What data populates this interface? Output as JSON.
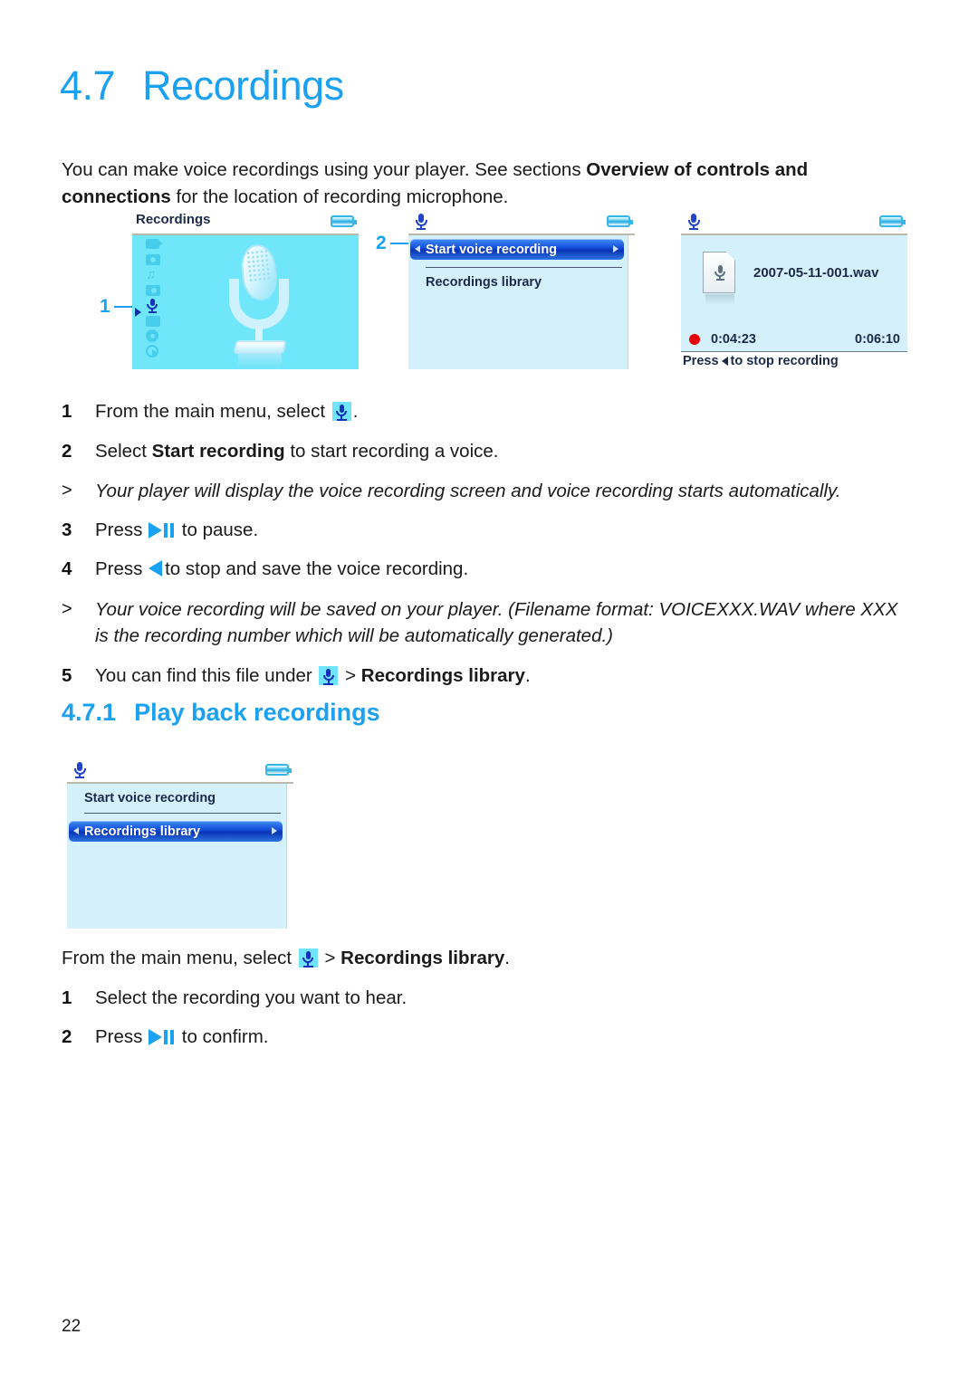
{
  "heading": {
    "number": "4.7",
    "title": "Recordings"
  },
  "intro": {
    "part1": "You can make voice recordings using your player. See sections ",
    "bold1": "Overview of controls and connections",
    "part2": " for the location of recording microphone."
  },
  "screens": {
    "screen1": {
      "title": "Recordings",
      "battery_icon": "battery-icon",
      "menu_icons": [
        "video-camera-icon",
        "camera-icon",
        "music-note-icon",
        "camera-radio-icon",
        "microphone-icon",
        "folder-icon",
        "gear-icon",
        "play-circle-icon"
      ],
      "selected_icon": "microphone-icon",
      "artwork": "microphone-illustration"
    },
    "screen2": {
      "title_icon": "microphone-icon",
      "battery_icon": "battery-icon",
      "items": [
        {
          "label": "Start voice recording",
          "selected": true
        },
        {
          "label": "Recordings library",
          "selected": false
        }
      ]
    },
    "screen3": {
      "title_icon": "microphone-icon",
      "battery_icon": "battery-icon",
      "file_icon": "wav-file-icon",
      "filename": "2007-05-11-001.wav",
      "record_indicator": "record-dot-icon",
      "elapsed_time": "0:04:23",
      "total_time": "0:06:10",
      "footer_before": "Press",
      "footer_after": "to stop recording"
    },
    "screen4": {
      "title_icon": "microphone-icon",
      "battery_icon": "battery-icon",
      "items": [
        {
          "label": "Start voice recording",
          "selected": false
        },
        {
          "label": "Recordings library",
          "selected": true
        }
      ]
    }
  },
  "callouts": [
    {
      "label": "1"
    },
    {
      "label": "2"
    }
  ],
  "steps_upper": [
    {
      "marker": "1",
      "text_before": "From the main menu, select ",
      "icon": "microphone-icon",
      "text_after": "."
    },
    {
      "marker": "2",
      "text_before": "Select ",
      "bold": "Start recording",
      "text_after": " to start recording a voice."
    },
    {
      "marker": ">",
      "italic": true,
      "text_before": "Your player will display the voice recording screen and voice recording starts automatically."
    },
    {
      "marker": "3",
      "text_before": "Press ",
      "icon": "play-pause-icon",
      "text_after": " to pause."
    },
    {
      "marker": "4",
      "text_before": "Press ",
      "icon": "left-arrow-icon",
      "text_after": "to stop and save the voice recording."
    },
    {
      "marker": ">",
      "italic": true,
      "text_before": "Your voice recording will be saved on your player. (Filename format: VOICEXXX.WAV where XXX is the recording number which will be automatically generated.)"
    },
    {
      "marker": "5",
      "text_before": "You can find this file under ",
      "icon": "microphone-icon",
      "text_mid": " > ",
      "bold": "Recordings library",
      "text_after": "."
    }
  ],
  "subheading": {
    "number": "4.7.1",
    "title": "Play back recordings"
  },
  "steps_lower": [
    {
      "marker": "",
      "text_before": "From the main menu, select ",
      "icon": "microphone-icon",
      "text_mid": " > ",
      "bold": "Recordings library",
      "text_after": "."
    },
    {
      "marker": "1",
      "text_before": "Select the recording you want to hear."
    },
    {
      "marker": "2",
      "text_before": "Press ",
      "icon": "play-pause-icon",
      "text_after": " to confirm."
    }
  ],
  "page_number": "22",
  "colors": {
    "accent": "#1BA1F2",
    "screen_bg": "#6FE6FA",
    "list_bg": "#d4f1fb",
    "highlight": "#0b34b4",
    "record_dot": "#e60000"
  }
}
